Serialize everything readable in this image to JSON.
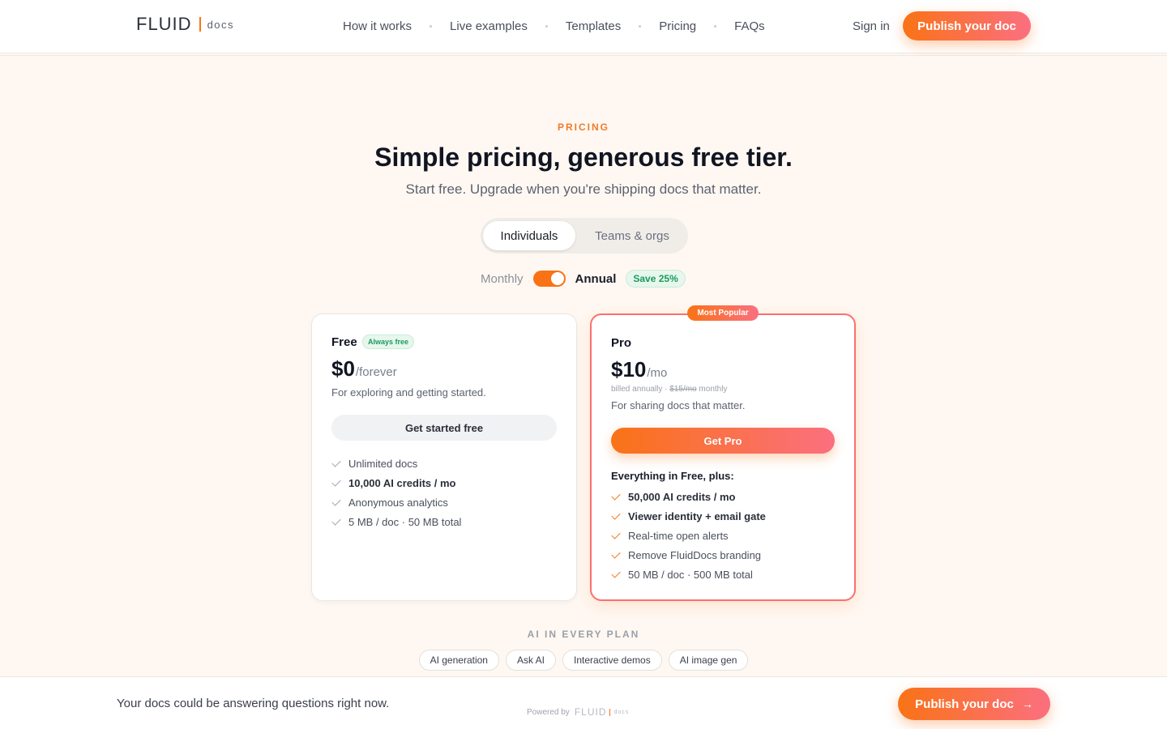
{
  "header": {
    "logo_word": "FLUID",
    "logo_suffix": "docs",
    "nav": [
      "How it works",
      "Live examples",
      "Templates",
      "Pricing",
      "FAQs"
    ],
    "sign_in": "Sign in",
    "publish": "Publish your doc"
  },
  "hero": {
    "eyebrow": "PRICING",
    "title": "Simple pricing, generous free tier.",
    "subtitle": "Start free. Upgrade when you're shipping docs that matter."
  },
  "segment": {
    "active": "Individuals",
    "inactive": "Teams & orgs"
  },
  "billing": {
    "monthly": "Monthly",
    "annual": "Annual",
    "save": "Save 25%",
    "annual_selected": true
  },
  "plans": {
    "free": {
      "name": "Free",
      "badge": "Always free",
      "price": "$0",
      "period": "/forever",
      "desc": "For exploring and getting started.",
      "cta": "Get started free",
      "features": [
        {
          "text": "Unlimited docs",
          "bold": false
        },
        {
          "text": "10,000 AI credits / mo",
          "bold": true
        },
        {
          "text": "Anonymous analytics",
          "bold": false
        },
        {
          "text": "5 MB / doc · 50 MB total",
          "bold": false
        }
      ]
    },
    "pro": {
      "popular": "Most Popular",
      "name": "Pro",
      "price": "$10",
      "period": "/mo",
      "billed_prefix": "billed annually ·",
      "billed_strike": "$15/mo",
      "billed_suffix": "monthly",
      "desc": "For sharing docs that matter.",
      "cta": "Get Pro",
      "plus_heading": "Everything in Free, plus:",
      "features": [
        {
          "text": "50,000 AI credits / mo",
          "bold": true
        },
        {
          "text": "Viewer identity + email gate",
          "bold": true
        },
        {
          "text": "Real-time open alerts",
          "bold": false
        },
        {
          "text": "Remove FluidDocs branding",
          "bold": false
        },
        {
          "text": "50 MB / doc · 500 MB total",
          "bold": false
        }
      ]
    }
  },
  "ai": {
    "label": "AI IN EVERY PLAN",
    "chips": [
      "AI generation",
      "Ask AI",
      "Interactive demos",
      "AI image gen"
    ]
  },
  "footer": {
    "text": "Your docs could be answering questions right now.",
    "powered_by": "Powered by",
    "powered_logo": "FLUID",
    "powered_suffix": "docs",
    "publish": "Publish your doc"
  },
  "colors": {
    "accent": "#f97316",
    "accent_end": "#fb6f80",
    "success": "#1d9a5a"
  }
}
